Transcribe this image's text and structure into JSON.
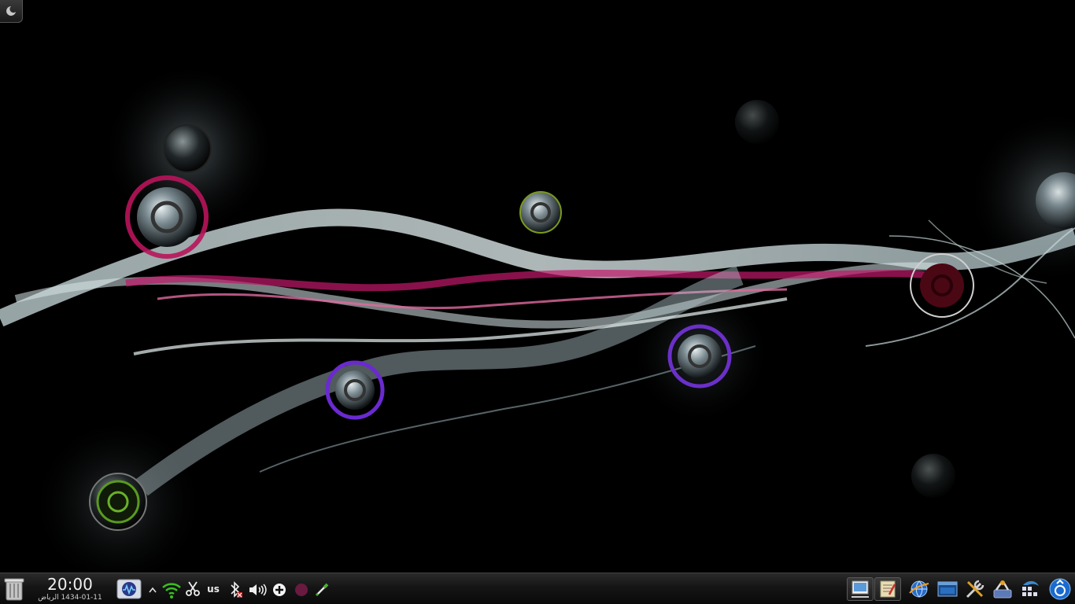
{
  "desktop": {
    "cashew_icon": "plasma-toolbox-icon"
  },
  "panel": {
    "launcher_icon": "trash-icon",
    "clock": {
      "time": "20:00",
      "date": "1434-01-11 الرياض"
    },
    "systray": {
      "app_icon": "system-monitor-icon",
      "expand_icon": "chevron-up-icon",
      "keyboard_layout": "us",
      "icons": [
        "wifi-icon",
        "scissors-icon",
        "bluetooth-disabled-icon",
        "volume-icon",
        "add-icon",
        "record-icon",
        "color-picker-icon"
      ]
    },
    "tasks": [
      "screenshot-app-icon",
      "notes-app-icon"
    ],
    "quicklaunch": [
      "globe-network-icon",
      "desktop-window-icon",
      "tools-icon",
      "network-settings-icon",
      "dolphin-file-manager-icon",
      "fingerprint-update-icon"
    ]
  }
}
